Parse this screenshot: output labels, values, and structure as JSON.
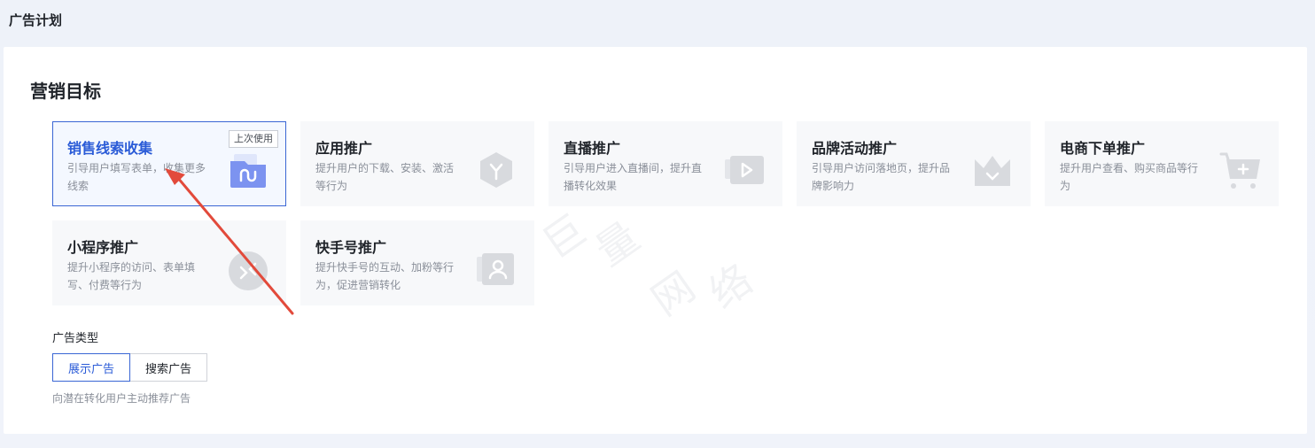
{
  "page": {
    "title": "广告计划"
  },
  "marketing": {
    "title": "营销目标",
    "cards": [
      {
        "title": "销售线索收集",
        "desc": "引导用户填写表单，收集更多线索",
        "badge": "上次使用",
        "icon": "folder-icon"
      },
      {
        "title": "应用推广",
        "desc": "提升用户的下载、安装、激活等行为",
        "icon": "app-icon"
      },
      {
        "title": "直播推广",
        "desc": "引导用户进入直播间，提升直播转化效果",
        "icon": "live-icon"
      },
      {
        "title": "品牌活动推广",
        "desc": "引导用户访问落地页，提升品牌影响力",
        "icon": "crown-icon"
      },
      {
        "title": "电商下单推广",
        "desc": "提升用户查看、购买商品等行为",
        "icon": "cart-icon"
      },
      {
        "title": "小程序推广",
        "desc": "提升小程序的访问、表单填写、付费等行为",
        "icon": "mini-program-icon"
      },
      {
        "title": "快手号推广",
        "desc": "提升快手号的互动、加粉等行为，促进营销转化",
        "icon": "user-icon"
      }
    ]
  },
  "ad_type": {
    "label": "广告类型",
    "options": [
      "展示广告",
      "搜索广告"
    ],
    "selected": "展示广告",
    "hint": "向潜在转化用户主动推荐广告"
  },
  "watermark": [
    "巨",
    "量",
    "网",
    "络"
  ],
  "colors": {
    "accent": "#2a5bd7",
    "border_selected": "#3a66d4",
    "arrow": "#e24a3b"
  }
}
